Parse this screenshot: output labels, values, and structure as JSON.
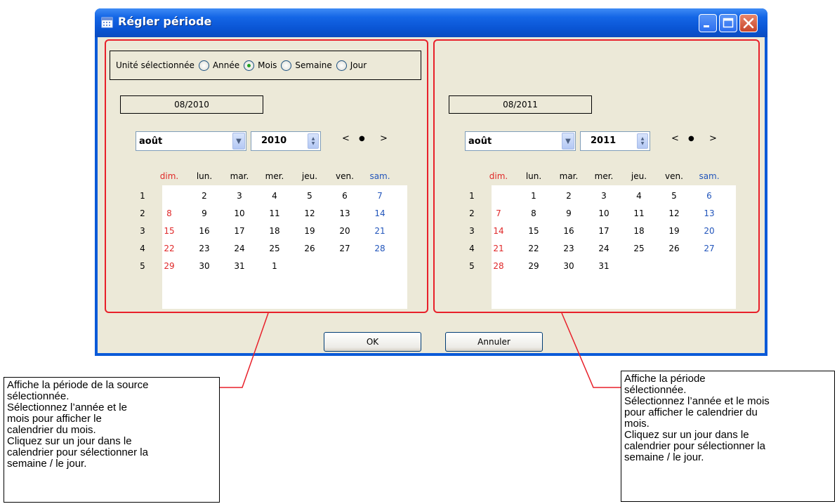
{
  "window": {
    "title": "Régler période",
    "title_icon": "calendar-icon",
    "controls": [
      "minimize-icon",
      "maximize-icon",
      "close-icon"
    ]
  },
  "unit_selector": {
    "label": "Unité sélectionnée",
    "options": [
      "Année",
      "Mois",
      "Semaine",
      "Jour"
    ],
    "selected": "Mois"
  },
  "left_panel": {
    "period": "08/2010",
    "month": "août",
    "year": "2010",
    "nav_prev": "<",
    "nav_today": "●",
    "nav_next": ">",
    "weekdays": [
      "dim.",
      "lun.",
      "mar.",
      "mer.",
      "jeu.",
      "ven.",
      "sam."
    ],
    "weeks": [
      {
        "num": "1",
        "days": [
          "",
          "2",
          "3",
          "4",
          "5",
          "6",
          "7"
        ]
      },
      {
        "num": "2",
        "days": [
          "8",
          "9",
          "10",
          "11",
          "12",
          "13",
          "14"
        ]
      },
      {
        "num": "3",
        "days": [
          "15",
          "16",
          "17",
          "18",
          "19",
          "20",
          "21"
        ]
      },
      {
        "num": "4",
        "days": [
          "22",
          "23",
          "24",
          "25",
          "26",
          "27",
          "28"
        ]
      },
      {
        "num": "5",
        "days": [
          "29",
          "30",
          "31",
          "1",
          "",
          "",
          ""
        ]
      }
    ]
  },
  "right_panel": {
    "period": "08/2011",
    "month": "août",
    "year": "2011",
    "nav_prev": "<",
    "nav_today": "●",
    "nav_next": ">",
    "weekdays": [
      "dim.",
      "lun.",
      "mar.",
      "mer.",
      "jeu.",
      "ven.",
      "sam."
    ],
    "weeks": [
      {
        "num": "1",
        "days": [
          "",
          "1",
          "2",
          "3",
          "4",
          "5",
          "6"
        ]
      },
      {
        "num": "2",
        "days": [
          "7",
          "8",
          "9",
          "10",
          "11",
          "12",
          "13"
        ]
      },
      {
        "num": "3",
        "days": [
          "14",
          "15",
          "16",
          "17",
          "18",
          "19",
          "20"
        ]
      },
      {
        "num": "4",
        "days": [
          "21",
          "22",
          "23",
          "24",
          "25",
          "26",
          "27"
        ]
      },
      {
        "num": "5",
        "days": [
          "28",
          "29",
          "30",
          "31",
          "",
          "",
          ""
        ]
      }
    ]
  },
  "buttons": {
    "ok": "OK",
    "cancel": "Annuler"
  },
  "callouts": {
    "left": [
      "Affiche la période de la source",
      "sélectionnée.",
      "Sélectionnez l’année et le",
      "mois pour afficher le",
      "calendrier du mois.",
      "Cliquez sur un jour dans le",
      "calendrier pour sélectionner la",
      "semaine / le jour."
    ],
    "right": [
      "Affiche la période",
      "sélectionnée.",
      "Sélectionnez l’année et le mois",
      "pour afficher le calendrier du",
      "mois.",
      "Cliquez sur un jour dans le",
      "calendrier pour sélectionner la",
      "semaine / le jour."
    ]
  },
  "colors": {
    "title_bar": "#0a55d4",
    "panel_border": "#e8202a",
    "sunday": "#e02828",
    "saturday": "#2255bb",
    "window_bg": "#ece9d8"
  }
}
